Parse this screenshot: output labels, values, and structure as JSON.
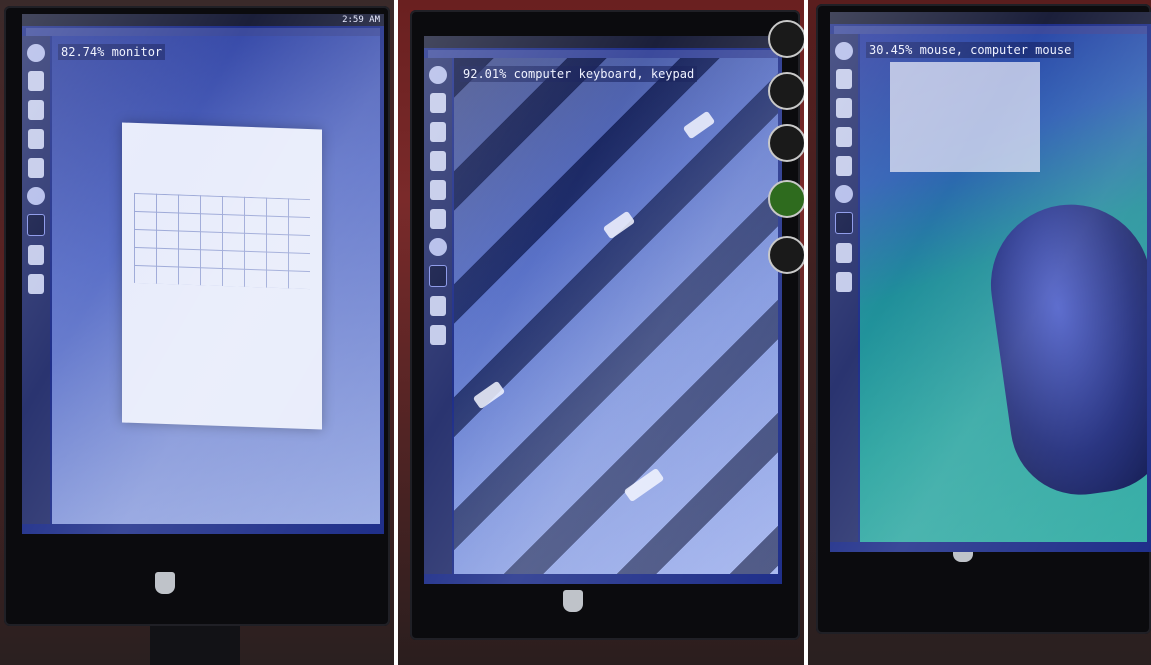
{
  "panels": [
    {
      "detection_label": "82.74% monitor",
      "tray_time": "2:59 AM"
    },
    {
      "detection_label": "92.01% computer keyboard, keypad"
    },
    {
      "detection_label": "30.45% mouse, computer mouse"
    }
  ]
}
